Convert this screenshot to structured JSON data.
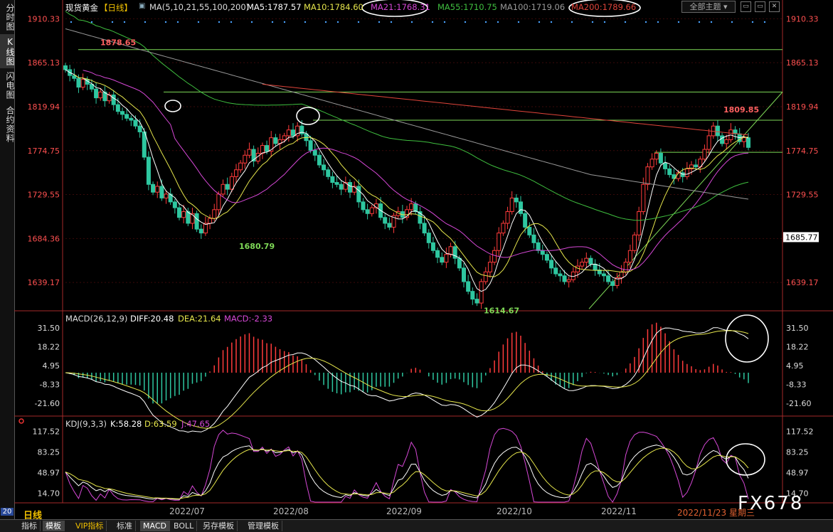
{
  "sidebar": {
    "tabs": [
      {
        "label": "分时图",
        "active": false
      },
      {
        "label": "K线图",
        "active": true
      },
      {
        "label": "闪电图",
        "active": false
      },
      {
        "label": "合约资料",
        "active": false
      }
    ]
  },
  "header": {
    "instrument": "现货黄金",
    "period_tag": "【日线】",
    "ma_params": "MA(5,10,21,55,100,200)",
    "ma5": "MA5:1787.57",
    "ma10": "MA10:1784.60",
    "ma21": "MA21:1768.31",
    "ma55": "MA55:1710.75",
    "ma100": "MA100:1719.06",
    "ma200": "MA200:1789.66",
    "theme_button": "全部主题",
    "theme_caret": "▾",
    "win_icons": [
      "▭",
      "▭",
      "✕"
    ]
  },
  "macd_header": {
    "params": "MACD(26,12,9)",
    "diff": "DIFF:20.48",
    "dea": "DEA:21.64",
    "macd": "MACD:-2.33"
  },
  "kdj_header": {
    "params": "KDJ(9,3,3)",
    "k": "K:58.28",
    "d": "D:63.59",
    "j": "J:47.65"
  },
  "price_axis": [
    "1910.33",
    "1865.13",
    "1819.94",
    "1774.75",
    "1729.55",
    "1684.36",
    "1639.17"
  ],
  "current_price": "1685.77",
  "macd_axis": [
    "31.50",
    "18.22",
    "4.95",
    "-8.33",
    "-21.60"
  ],
  "kdj_axis": [
    "117.52",
    "83.25",
    "48.97",
    "14.70"
  ],
  "x_axis": [
    "2022/07",
    "2022/08",
    "2022/09",
    "2022/10",
    "2022/11"
  ],
  "date_stamp": "2022/11/23 星期三",
  "period_label": "日线",
  "logo": "FX678",
  "bottom_tabs": [
    {
      "label": "指标",
      "active": false
    },
    {
      "label": "模板",
      "active": true
    },
    {
      "label": "VIP指标",
      "active": false
    },
    {
      "label": "标准",
      "active": false
    },
    {
      "label": "MACD",
      "active": true
    },
    {
      "label": "BOLL",
      "active": false
    },
    {
      "label": "另存模板",
      "active": false
    },
    {
      "label": "管理模板",
      "active": false
    }
  ],
  "corner_label": "20",
  "colors": {
    "up": "#ff3b3b",
    "down": "#2ec7a0",
    "ma5": "#ffffff",
    "ma10": "#e6e64c",
    "ma21": "#d648d6",
    "ma55": "#3fbf3f",
    "ma100": "#9a9a9a",
    "ma200": "#e0443a",
    "grid": "#8b1a1a",
    "annotation_green": "#7ed957"
  },
  "chart_data": [
    {
      "type": "candlestick",
      "title": "现货黄金 日线",
      "ylim": [
        1610,
        1915
      ],
      "yticks": [
        1910.33,
        1865.13,
        1819.94,
        1774.75,
        1729.55,
        1684.36,
        1639.17
      ],
      "x_labels": [
        "2022/07",
        "2022/08",
        "2022/09",
        "2022/10",
        "2022/11"
      ],
      "annotations": [
        {
          "label": "1878.65",
          "value": 1878.65
        },
        {
          "label": "1680.79",
          "value": 1680.79
        },
        {
          "label": "1614.67",
          "value": 1614.67
        },
        {
          "label": "1809.85",
          "value": 1809.85
        }
      ],
      "horizontal_levels": [
        1878.65,
        1835.0,
        1806.0,
        1773.0
      ],
      "trendline": {
        "from": 1612.0,
        "to": 1835.0
      },
      "close_series": [
        1858,
        1852,
        1849,
        1840,
        1848,
        1843,
        1838,
        1829,
        1835,
        1826,
        1832,
        1822,
        1815,
        1812,
        1808,
        1806,
        1800,
        1794,
        1768,
        1740,
        1732,
        1738,
        1726,
        1730,
        1722,
        1716,
        1706,
        1712,
        1700,
        1710,
        1694,
        1690,
        1700,
        1705,
        1714,
        1730,
        1740,
        1735,
        1748,
        1755,
        1762,
        1770,
        1776,
        1764,
        1772,
        1780,
        1774,
        1788,
        1782,
        1786,
        1790,
        1796,
        1790,
        1800,
        1792,
        1785,
        1775,
        1770,
        1760,
        1755,
        1748,
        1742,
        1740,
        1735,
        1742,
        1732,
        1738,
        1722,
        1714,
        1710,
        1716,
        1720,
        1706,
        1700,
        1696,
        1708,
        1712,
        1706,
        1714,
        1720,
        1712,
        1700,
        1690,
        1680,
        1672,
        1665,
        1660,
        1668,
        1676,
        1664,
        1654,
        1640,
        1630,
        1622,
        1618,
        1640,
        1650,
        1660,
        1672,
        1690,
        1700,
        1712,
        1726,
        1722,
        1710,
        1696,
        1688,
        1680,
        1672,
        1668,
        1662,
        1654,
        1648,
        1646,
        1640,
        1642,
        1650,
        1656,
        1660,
        1664,
        1658,
        1652,
        1648,
        1646,
        1640,
        1636,
        1644,
        1650,
        1660,
        1672,
        1688,
        1712,
        1740,
        1758,
        1766,
        1772,
        1762,
        1756,
        1750,
        1746,
        1752,
        1748,
        1756,
        1760,
        1758,
        1766,
        1776,
        1790,
        1800,
        1790,
        1782,
        1786,
        1796,
        1792,
        1784,
        1788,
        1778
      ],
      "ma_lines": [
        {
          "name": "MA5",
          "value": 1787.57
        },
        {
          "name": "MA10",
          "value": 1784.6
        },
        {
          "name": "MA21",
          "value": 1768.31
        },
        {
          "name": "MA55",
          "value": 1710.75
        },
        {
          "name": "MA100",
          "value": 1719.06
        },
        {
          "name": "MA200",
          "value": 1789.66
        }
      ]
    },
    {
      "type": "bar",
      "title": "MACD(26,12,9)",
      "ylim": [
        -28,
        36
      ],
      "yticks": [
        31.5,
        18.22,
        4.95,
        -8.33,
        -21.6
      ],
      "series": [
        {
          "name": "DIFF",
          "last": 20.48
        },
        {
          "name": "DEA",
          "last": 21.64
        },
        {
          "name": "MACD",
          "last": -2.33
        }
      ]
    },
    {
      "type": "line",
      "title": "KDJ(9,3,3)",
      "ylim": [
        0,
        125
      ],
      "yticks": [
        117.52,
        83.25,
        48.97,
        14.7
      ],
      "series": [
        {
          "name": "K",
          "last": 58.28
        },
        {
          "name": "D",
          "last": 63.59
        },
        {
          "name": "J",
          "last": 47.65
        }
      ]
    }
  ]
}
